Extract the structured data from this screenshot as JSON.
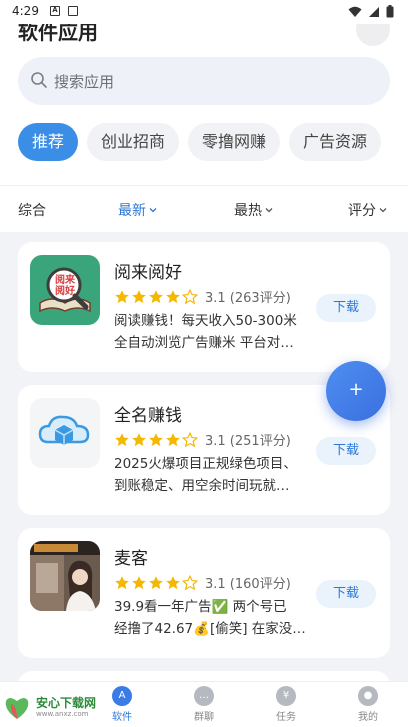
{
  "status_bar": {
    "time": "4:29"
  },
  "header": {
    "title": "软件应用"
  },
  "search": {
    "placeholder": "搜索应用"
  },
  "category_chips": [
    "推荐",
    "创业招商",
    "零撸网赚",
    "广告资源"
  ],
  "filters": [
    "综合",
    "最新",
    "最热",
    "评分"
  ],
  "apps": [
    {
      "name": "阅来阅好",
      "stars": 4,
      "rating_text": "3.1 (263评分)",
      "desc_line1": "阅读赚钱！每天收入50-300米",
      "desc_line2": "全自动浏览广告赚米 平台对…",
      "download_label": "下载",
      "icon_text": "阅来阅好"
    },
    {
      "name": "全名赚钱",
      "stars": 4,
      "rating_text": "3.1 (251评分)",
      "desc_line1": "2025火爆项目正规绿色项目、",
      "desc_line2": "到账稳定、用空余时间玩就…",
      "download_label": "下载"
    },
    {
      "name": "麦客",
      "stars": 4,
      "rating_text": "3.1 (160评分)",
      "desc_line1": "39.9看一年广告✅ 两个号已",
      "desc_line2": "经撸了42.67💰[偷笑] 在家没…",
      "download_label": "下载"
    }
  ],
  "fab": {
    "label": "+"
  },
  "bottom_nav": [
    "软件",
    "群聊",
    "任务",
    "我的"
  ],
  "watermark": {
    "brand": "安心下载网",
    "url": "www.anxz.com"
  },
  "colors": {
    "accent": "#3a8ee6",
    "star": "#f5b800",
    "fab": "#3a6fe0"
  }
}
